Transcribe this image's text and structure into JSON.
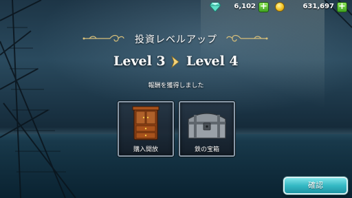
{
  "currency": {
    "gems": "6,102",
    "coins": "631,697",
    "gem_icon": "diamond-icon",
    "coin_icon": "gold-coin-icon"
  },
  "popup": {
    "title": "投資レベルアップ",
    "level_from": "Level 3",
    "level_to": "Level 4",
    "reward_message": "報酬を獲得しました",
    "rewards": [
      {
        "label": "購入開放",
        "icon": "cabinet-icon"
      },
      {
        "label": "鉄の宝箱",
        "icon": "iron-chest-icon"
      }
    ],
    "confirm_label": "確認"
  },
  "colors": {
    "accent_cyan": "#35b9c4",
    "plus_green": "#3fa21f",
    "ornament_gold": "#d9c07a"
  }
}
